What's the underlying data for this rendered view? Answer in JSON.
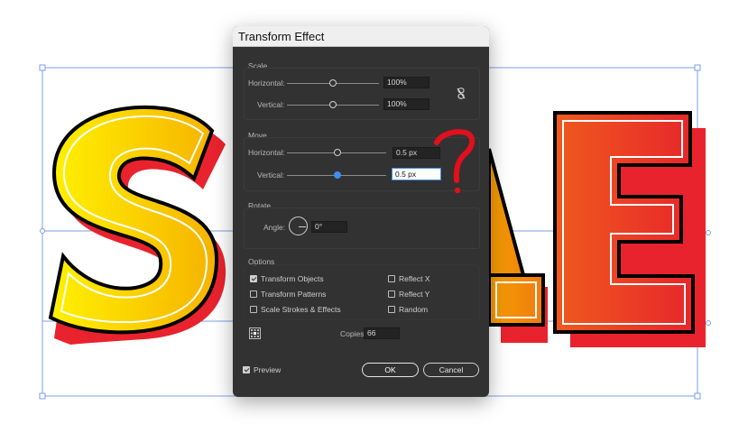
{
  "canvas": {
    "artwork_text": "SALE",
    "colors": {
      "yellow": "#ffe600",
      "orange": "#f7a100",
      "red": "#e8232d",
      "outline": "#000000"
    }
  },
  "dialog": {
    "title": "Transform Effect",
    "scale": {
      "label": "Scale",
      "horizontal_label": "Horizontal:",
      "horizontal_value": "100%",
      "vertical_label": "Vertical:",
      "vertical_value": "100%",
      "link_icon": "link-icon"
    },
    "move": {
      "label": "Move",
      "horizontal_label": "Horizontal:",
      "horizontal_value": "0.5 px",
      "vertical_label": "Vertical:",
      "vertical_value": "0.5 px"
    },
    "rotate": {
      "label": "Rotate",
      "angle_label": "Angle:",
      "angle_value": "0°"
    },
    "options": {
      "label": "Options",
      "items": [
        {
          "label": "Transform Objects",
          "checked": true
        },
        {
          "label": "Transform Patterns",
          "checked": false
        },
        {
          "label": "Scale Strokes & Effects",
          "checked": false
        },
        {
          "label": "Reflect X",
          "checked": false
        },
        {
          "label": "Reflect Y",
          "checked": false
        },
        {
          "label": "Random",
          "checked": false
        }
      ]
    },
    "copies_label": "Copies",
    "copies_value": "66",
    "preview_label": "Preview",
    "preview_checked": true,
    "ok_label": "OK",
    "cancel_label": "Cancel"
  },
  "annotation": {
    "glyph": "?",
    "color": "#e0101c"
  }
}
